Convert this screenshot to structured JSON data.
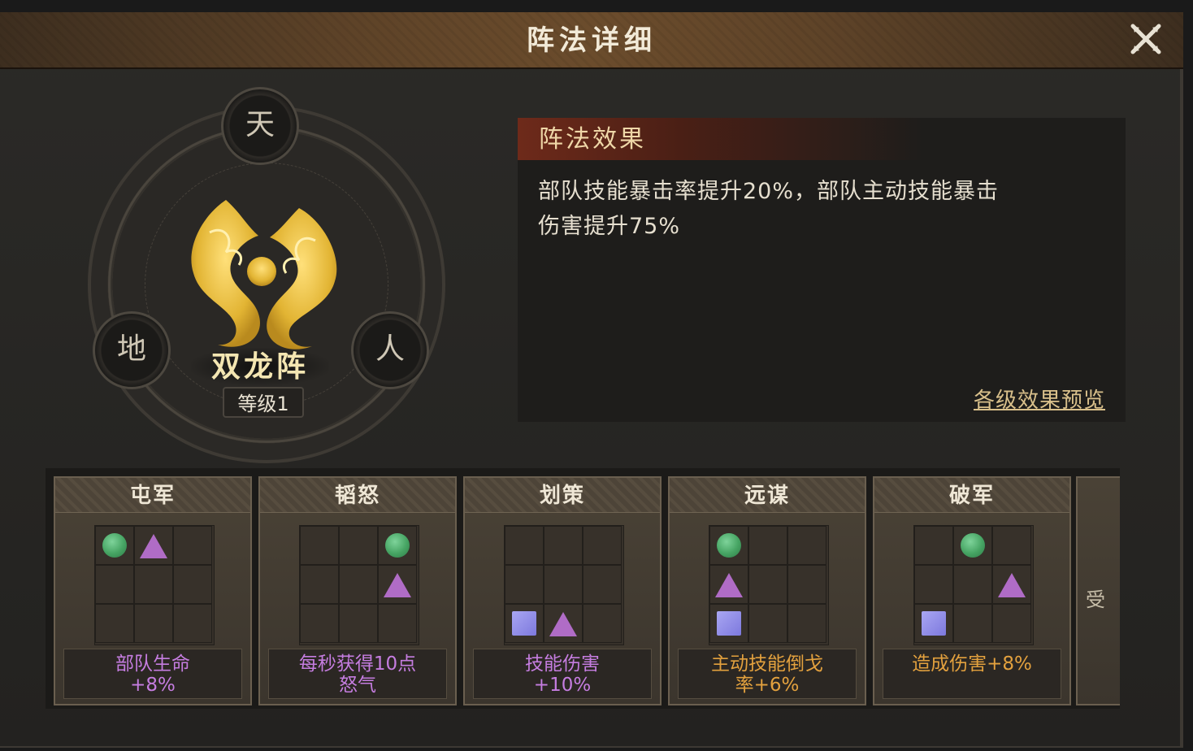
{
  "header": {
    "title": "阵法详细",
    "close_icon": "close-icon"
  },
  "formation": {
    "name": "双龙阵",
    "level": "等级1",
    "nodes": {
      "top": "天",
      "left": "地",
      "right": "人"
    },
    "emblem_icon": "twin-dragon-icon"
  },
  "effect": {
    "header": "阵法效果",
    "text_line1": "部队技能暴击率提升20%，部队主动技能暴击",
    "text_line2": "伤害提升75%",
    "preview_link": "各级效果预览"
  },
  "cards": [
    {
      "title": "屯军",
      "desc": "部队生命\n+8%",
      "desc_color": "#c57de0",
      "grid": [
        "circle",
        "triangle",
        "",
        "",
        "",
        "",
        "",
        "",
        ""
      ]
    },
    {
      "title": "韬怒",
      "desc": "每秒获得10点\n怒气",
      "desc_color": "#c57de0",
      "grid": [
        "",
        "",
        "circle",
        "",
        "",
        "triangle",
        "",
        "",
        ""
      ]
    },
    {
      "title": "划策",
      "desc": "技能伤害\n+10%",
      "desc_color": "#c57de0",
      "grid": [
        "",
        "",
        "",
        "",
        "",
        "",
        "square",
        "triangle",
        ""
      ]
    },
    {
      "title": "远谋",
      "desc": "主动技能倒戈\n率+6%",
      "desc_color": "#e3a13e",
      "grid": [
        "circle",
        "",
        "",
        "triangle",
        "",
        "",
        "square",
        "",
        ""
      ]
    },
    {
      "title": "破军",
      "desc": "造成伤害+8%",
      "desc_color": "#e3a13e",
      "grid": [
        "",
        "circle",
        "",
        "",
        "",
        "triangle",
        "square",
        "",
        ""
      ]
    }
  ],
  "partial_card": {
    "text": "受"
  }
}
